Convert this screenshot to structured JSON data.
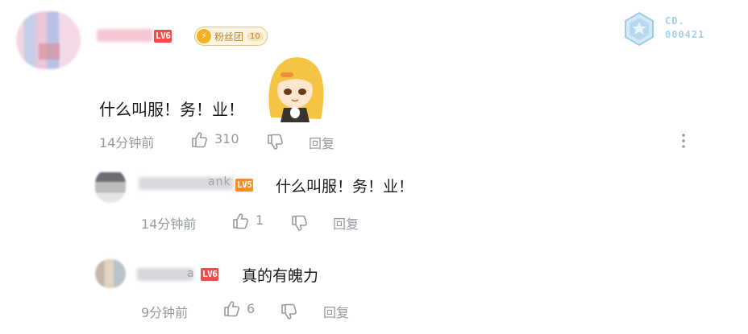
{
  "top_comment": {
    "level": "LV6",
    "fan_badge": {
      "label": "粉丝团",
      "level": "10"
    },
    "medal": {
      "line1": "CD.",
      "line2": "000421"
    },
    "text": "什么叫服！务！业！",
    "time": "14分钟前",
    "likes": "310",
    "reply_label": "回复"
  },
  "replies": [
    {
      "name_visible": "ank",
      "level": "LV5",
      "text": "什么叫服！务！业！",
      "time": "14分钟前",
      "likes": "1",
      "reply_label": "回复"
    },
    {
      "name_visible": "a",
      "level": "LV6",
      "text": "真的有魄力",
      "time": "9分钟前",
      "likes": "6",
      "reply_label": "回复"
    }
  ],
  "colors": {
    "meta_gray": "#9499a0",
    "lv6_red": "#f04c49",
    "lv5_orange": "#ff8c21",
    "fan_gold": "#f4b222",
    "medal_blue": "#a8d0eb"
  }
}
